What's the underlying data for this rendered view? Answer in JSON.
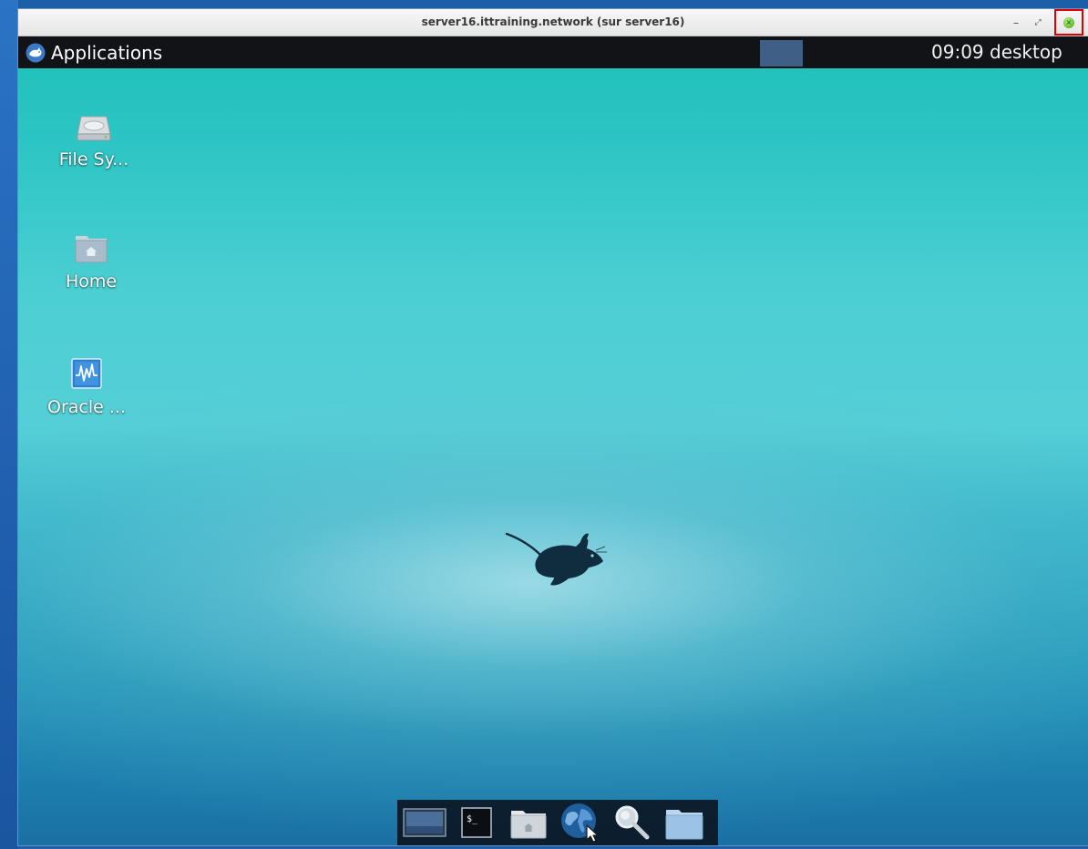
{
  "window": {
    "title": "server16.ittraining.network (sur server16)",
    "minimize_symbol": "–",
    "maximize_symbol": "⤢",
    "close_symbol": "×"
  },
  "panel": {
    "applications_label": "Applications",
    "clock_text": "09:09  desktop"
  },
  "desktop_icons": [
    {
      "label": "File Sy...",
      "icon": "drive-icon"
    },
    {
      "label": "Home",
      "icon": "home-folder-icon"
    },
    {
      "label": "Oracle ...",
      "icon": "monitor-icon"
    }
  ],
  "dock": {
    "items": [
      {
        "icon": "show-desktop-icon"
      },
      {
        "icon": "terminal-icon",
        "glyph_text": "$_"
      },
      {
        "icon": "home-folder-icon"
      },
      {
        "icon": "web-browser-icon"
      },
      {
        "icon": "search-icon"
      },
      {
        "icon": "folder-icon"
      }
    ]
  },
  "colors": {
    "panel": "#111317",
    "workspace": "#3f5f86",
    "close_highlight": "#e00000",
    "close_button": "#6fc43a"
  }
}
